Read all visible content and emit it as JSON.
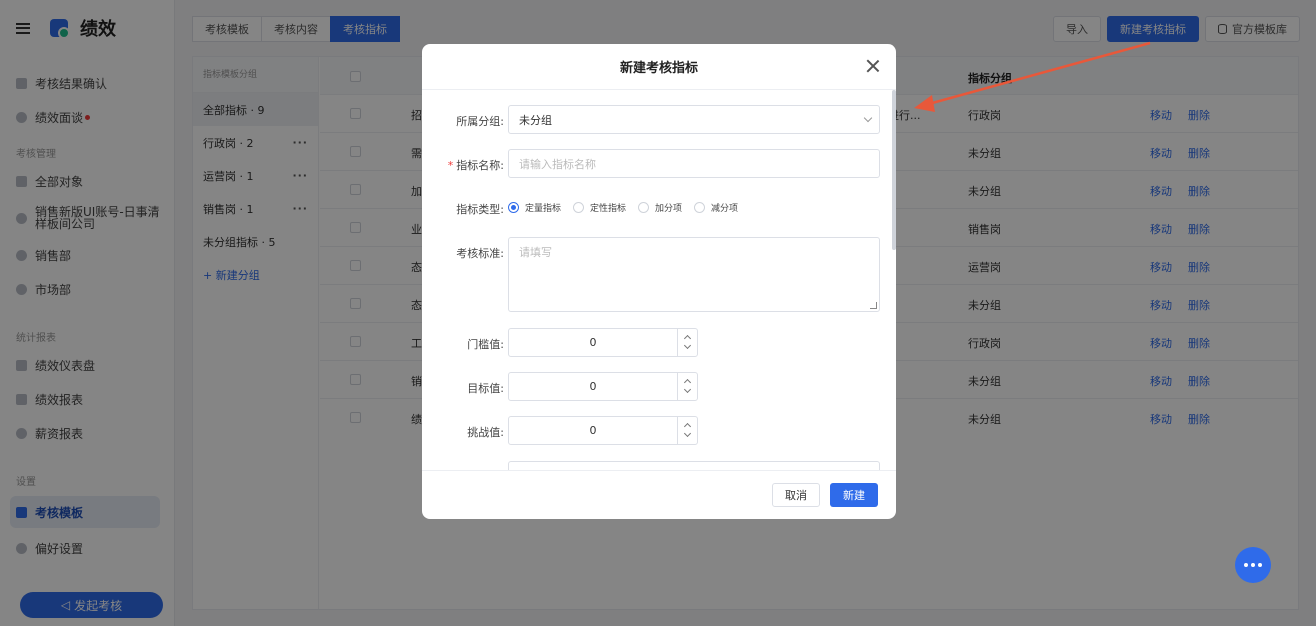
{
  "app": {
    "title": "绩效"
  },
  "sidebar": {
    "items_top": [
      {
        "label": "考核结果确认",
        "icon": "thumb-icon"
      },
      {
        "label": "绩效面谈",
        "icon": "chat-icon",
        "badge": true
      }
    ],
    "section_manage": "考核管理",
    "items_manage": [
      {
        "label": "全部对象",
        "icon": "grid-icon"
      },
      {
        "label_line1": "销售新版UI账号-日事清",
        "label_line2": "样板间公司",
        "icon": "shield-icon"
      },
      {
        "label": "销售部",
        "icon": "shield-icon"
      },
      {
        "label": "市场部",
        "icon": "shield-icon"
      }
    ],
    "section_report": "统计报表",
    "items_report": [
      {
        "label": "绩效仪表盘",
        "icon": "monitor-icon"
      },
      {
        "label": "绩效报表",
        "icon": "report-icon"
      },
      {
        "label": "薪资报表",
        "icon": "coin-icon"
      }
    ],
    "section_settings": "设置",
    "items_settings": [
      {
        "label": "考核模板",
        "icon": "template-icon",
        "active": true
      },
      {
        "label": "偏好设置",
        "icon": "settings-icon"
      }
    ],
    "launch_button": "发起考核"
  },
  "tabs": [
    {
      "label": "考核模板"
    },
    {
      "label": "考核内容"
    },
    {
      "label": "考核指标",
      "active": true
    }
  ],
  "toolbar": {
    "import": "导入",
    "new_metric": "新建考核指标",
    "official_library": "官方模板库"
  },
  "groups": {
    "header": "指标模板分组",
    "items": [
      {
        "label": "全部指标 · 9"
      },
      {
        "label": "行政岗 · 2",
        "more": "···"
      },
      {
        "label": "运营岗 · 1",
        "more": "···"
      },
      {
        "label": "销售岗 · 1",
        "more": "···"
      },
      {
        "label": "未分组指标 · 5"
      }
    ],
    "new_group": "+ 新建分组"
  },
  "table": {
    "header_group": "指标分组",
    "rows": [
      {
        "name": "招",
        "extra": "进行...",
        "group": "行政岗"
      },
      {
        "name": "需",
        "group": "未分组"
      },
      {
        "name": "加",
        "group": "未分组"
      },
      {
        "name": "业",
        "group": "销售岗"
      },
      {
        "name": "态",
        "group": "运营岗"
      },
      {
        "name": "态",
        "group": "未分组"
      },
      {
        "name": "工",
        "group": "行政岗"
      },
      {
        "name": "销",
        "group": "未分组"
      },
      {
        "name": "绩",
        "group": "未分组"
      }
    ],
    "op_move": "移动",
    "op_delete": "删除"
  },
  "modal": {
    "title": "新建考核指标",
    "group_label": "所属分组:",
    "group_value": "未分组",
    "name_label": "指标名称:",
    "name_placeholder": "请输入指标名称",
    "type_label": "指标类型:",
    "types": [
      {
        "label": "定量指标",
        "checked": true
      },
      {
        "label": "定性指标"
      },
      {
        "label": "加分项"
      },
      {
        "label": "减分项"
      }
    ],
    "standard_label": "考核标准:",
    "standard_placeholder": "请填写",
    "threshold_label": "门槛值:",
    "threshold_value": "0",
    "target_label": "目标值:",
    "target_value": "0",
    "challenge_label": "挑战值:",
    "challenge_value": "0",
    "cancel": "取消",
    "submit": "新建"
  },
  "colors": {
    "primary": "#2f6bea",
    "annotation_arrow": "#e8583a"
  }
}
